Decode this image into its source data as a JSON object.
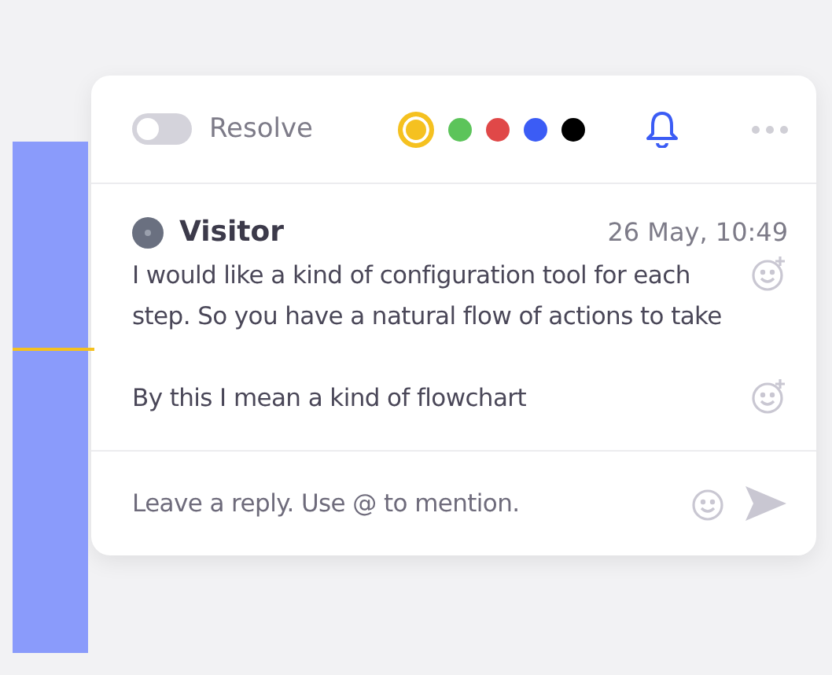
{
  "header": {
    "resolve": {
      "label": "Resolve",
      "on": false
    },
    "colors": [
      {
        "color": "#f5c120",
        "selected": true
      },
      {
        "color": "#5cc45a",
        "selected": false
      },
      {
        "color": "#e04848",
        "selected": false
      },
      {
        "color": "#3b5cf5",
        "selected": false
      },
      {
        "color": "#000000",
        "selected": false
      }
    ]
  },
  "comment": {
    "author": "Visitor",
    "time": "26 May, 10:49",
    "paragraphs": [
      "I would like a kind of configuration tool for each step. So you have a natural flow of actions to take",
      "By this I mean a kind of flowchart"
    ]
  },
  "reply": {
    "placeholder": "Leave a reply. Use @ to mention."
  }
}
